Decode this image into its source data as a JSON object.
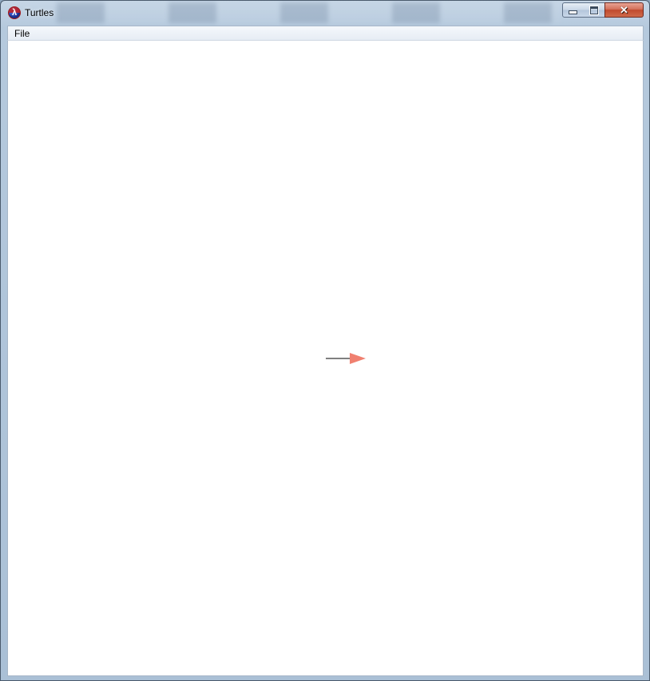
{
  "window": {
    "title": "Turtles",
    "app_icon": "lambda-icon",
    "controls": {
      "minimize_icon": "minimize-icon",
      "maximize_icon": "maximize-icon",
      "close_icon": "close-icon",
      "close_glyph": "✕"
    }
  },
  "menubar": {
    "items": [
      {
        "label": "File"
      }
    ]
  },
  "canvas": {
    "background": "#ffffff",
    "turtle": {
      "icon": "turtle-arrow-icon",
      "heading": "east",
      "fill": "#f08070",
      "trail_color": "#000000"
    }
  }
}
